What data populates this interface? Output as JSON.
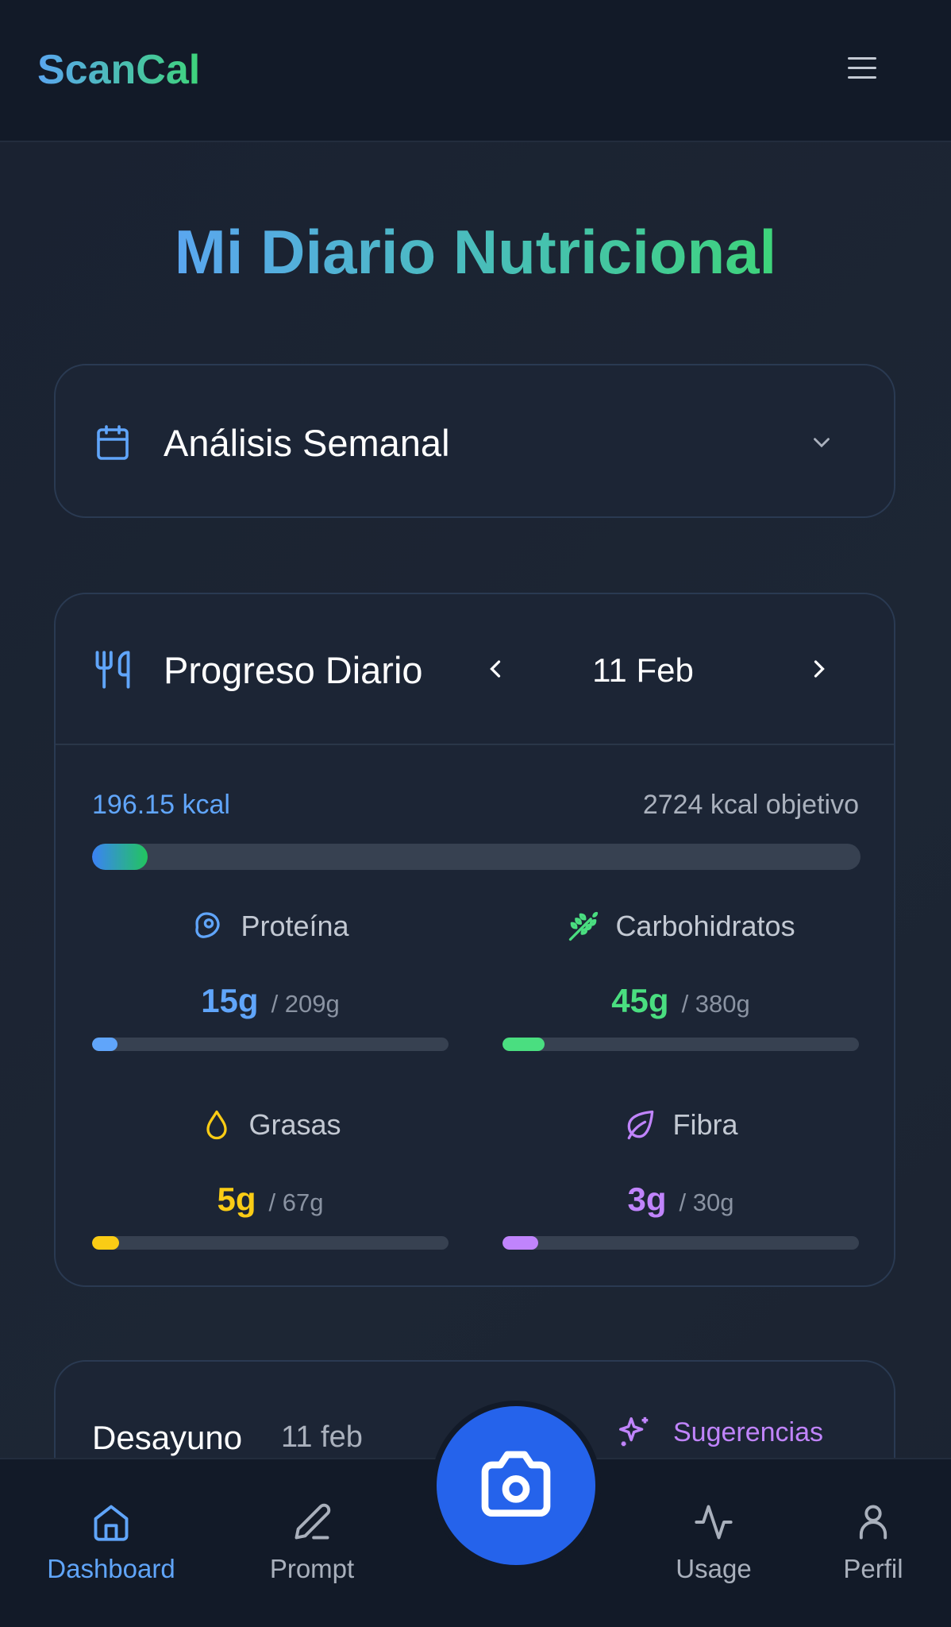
{
  "app": {
    "name": "ScanCal"
  },
  "page": {
    "title": "Mi Diario Nutricional"
  },
  "weekly": {
    "label": "Análisis Semanal",
    "icon": "calendar-icon"
  },
  "daily": {
    "label": "Progreso Diario",
    "icon": "utensils-icon",
    "date": "11 Feb",
    "consumed": "196.15 kcal",
    "goal": "2724 kcal objetivo",
    "progress_percent": 7.2,
    "macros": [
      {
        "name": "Proteína",
        "value": "15g",
        "goal": "/ 209g",
        "percent": 7.2,
        "color": "#60a5fa",
        "icon": "steak-icon"
      },
      {
        "name": "Carbohidratos",
        "value": "45g",
        "goal": "/ 380g",
        "percent": 11.8,
        "color": "#4ade80",
        "icon": "wheat-icon"
      },
      {
        "name": "Grasas",
        "value": "5g",
        "goal": "/ 67g",
        "percent": 7.5,
        "color": "#facc15",
        "icon": "droplet-icon"
      },
      {
        "name": "Fibra",
        "value": "3g",
        "goal": "/ 30g",
        "percent": 10,
        "color": "#c084fc",
        "icon": "leaf-icon"
      }
    ]
  },
  "meal": {
    "name": "Desayuno",
    "date": "11 feb",
    "suggestions": "Sugerencias"
  },
  "nav": [
    {
      "label": "Dashboard",
      "active": true
    },
    {
      "label": "Prompt"
    },
    {
      "label": "Usage"
    },
    {
      "label": "Perfil"
    }
  ],
  "colors": {
    "accent": "#2563eb",
    "active_nav": "#60a5fa"
  }
}
